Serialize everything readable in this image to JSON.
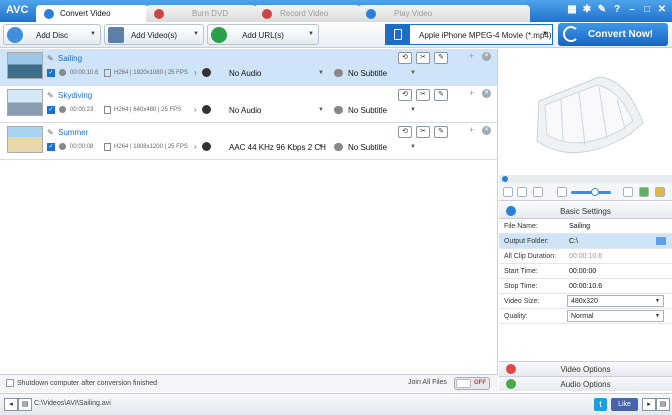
{
  "app": {
    "logo": "AVC"
  },
  "tabs": [
    {
      "label": "Convert Video"
    },
    {
      "label": "Burn DVD"
    },
    {
      "label": "Record Video"
    },
    {
      "label": "Play Video"
    }
  ],
  "toolbar": {
    "add_disc": "Add Disc",
    "add_videos": "Add Video(s)",
    "add_urls": "Add URL(s)",
    "format": "Apple iPhone MPEG-4 Movie (*.mp4)",
    "convert": "Convert Now!"
  },
  "files": [
    {
      "name": "Sailing",
      "duration": "00:00:10.6",
      "video": "H264 | 1920x1080 | 25 FPS",
      "audio": "No Audio",
      "subtitle": "No Subtitle"
    },
    {
      "name": "Skydiving",
      "duration": "00:00:23",
      "video": "H264 | 640x480 | 25 FPS",
      "audio": "No Audio",
      "subtitle": "No Subtitle"
    },
    {
      "name": "Summer",
      "duration": "00:00:08",
      "video": "H264 | 1808x1200 | 25 FPS",
      "audio": "AAC 44 KHz 96 Kbps 2 CH",
      "subtitle": "No Subtitle"
    }
  ],
  "bottom": {
    "shutdown": "Shutdown computer after conversion finished",
    "join": "Join All Files",
    "toggle": "OFF"
  },
  "status": {
    "path": "C:\\Videos\\AVI\\Sailing.avi",
    "like": "Like"
  },
  "settings": {
    "header": "Basic Settings",
    "rows": [
      {
        "label": "File Name:",
        "value": "Sailing"
      },
      {
        "label": "Output Folder:",
        "value": "C:\\"
      },
      {
        "label": "All Clip Duration:",
        "value": "00:00:10.6"
      },
      {
        "label": "Start Time:",
        "value": "00:00:00"
      },
      {
        "label": "Stop Time:",
        "value": "00:00:10.6"
      },
      {
        "label": "Video Size:",
        "value": "480x320"
      },
      {
        "label": "Quality:",
        "value": "Normal"
      }
    ],
    "video_options": "Video Options",
    "audio_options": "Audio Options"
  }
}
